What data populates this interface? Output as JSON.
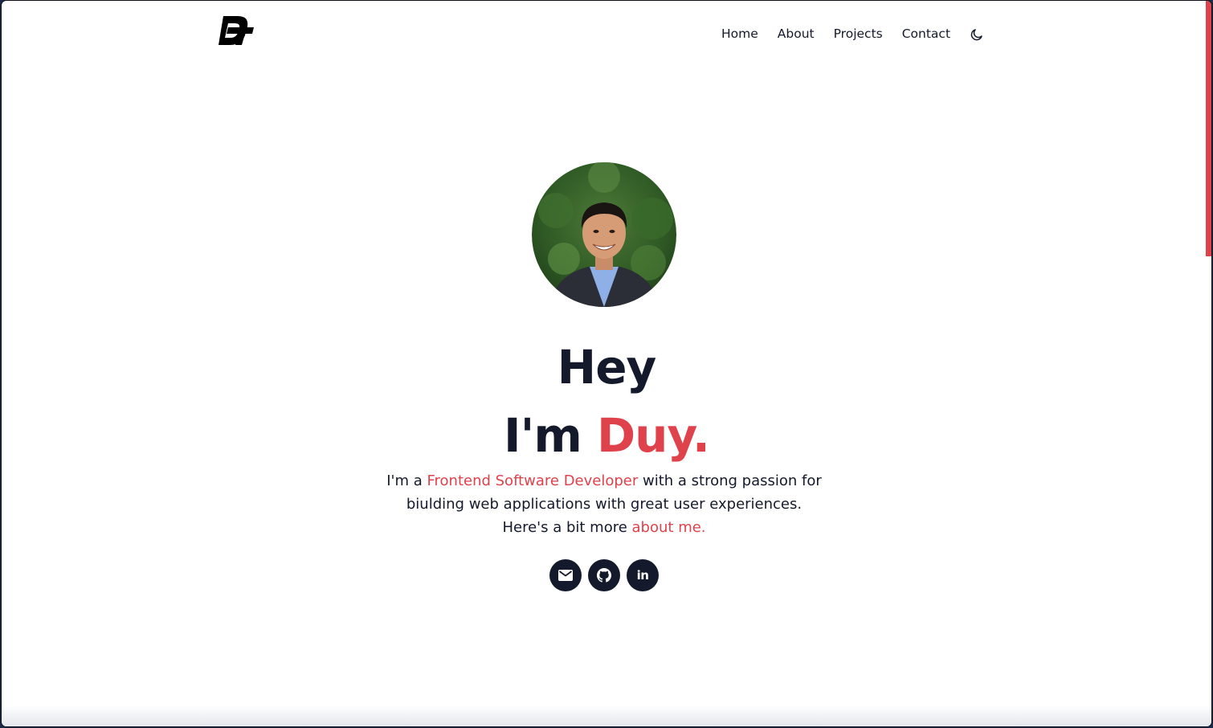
{
  "nav": {
    "items": [
      {
        "label": "Home"
      },
      {
        "label": "About"
      },
      {
        "label": "Projects"
      },
      {
        "label": "Contact"
      }
    ]
  },
  "hero": {
    "greeting": "Hey",
    "name_prefix": "I'm",
    "name": "Duy.",
    "intro": {
      "part1": "I'm a",
      "role": "Frontend Software Developer",
      "part2": "with a strong passion for",
      "line2": "biulding web applications with great user experiences.",
      "line3_prefix": "Here's a bit more",
      "about_link": "about me."
    },
    "socials": [
      {
        "icon": "mail-icon"
      },
      {
        "icon": "github-icon"
      },
      {
        "icon": "linkedin-icon",
        "glyph": "in"
      }
    ]
  },
  "colors": {
    "accent": "#e0424c",
    "text": "#141a2c",
    "background": "#ffffff"
  },
  "icons": {
    "logo": "dg-monogram-logo",
    "theme_toggle": "moon-icon"
  }
}
